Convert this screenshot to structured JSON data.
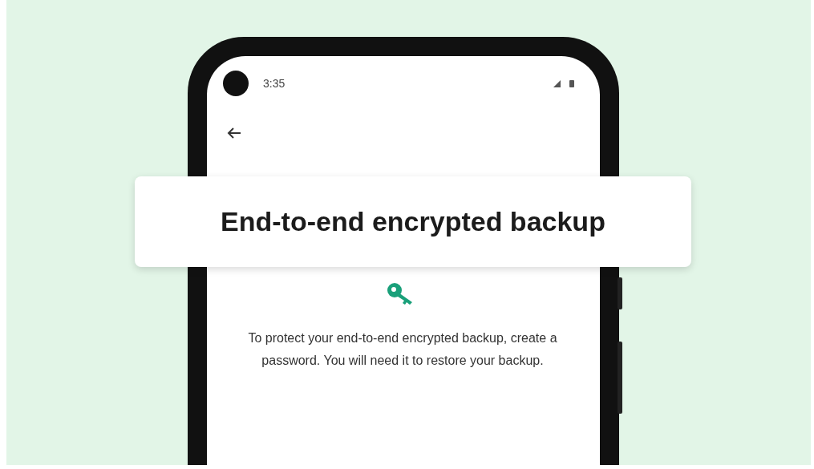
{
  "status_bar": {
    "time": "3:35"
  },
  "banner": {
    "title": "End-to-end encrypted backup"
  },
  "screen": {
    "message": "To protect your end-to-end encrypted backup, create a password. You will need it to restore your backup."
  }
}
